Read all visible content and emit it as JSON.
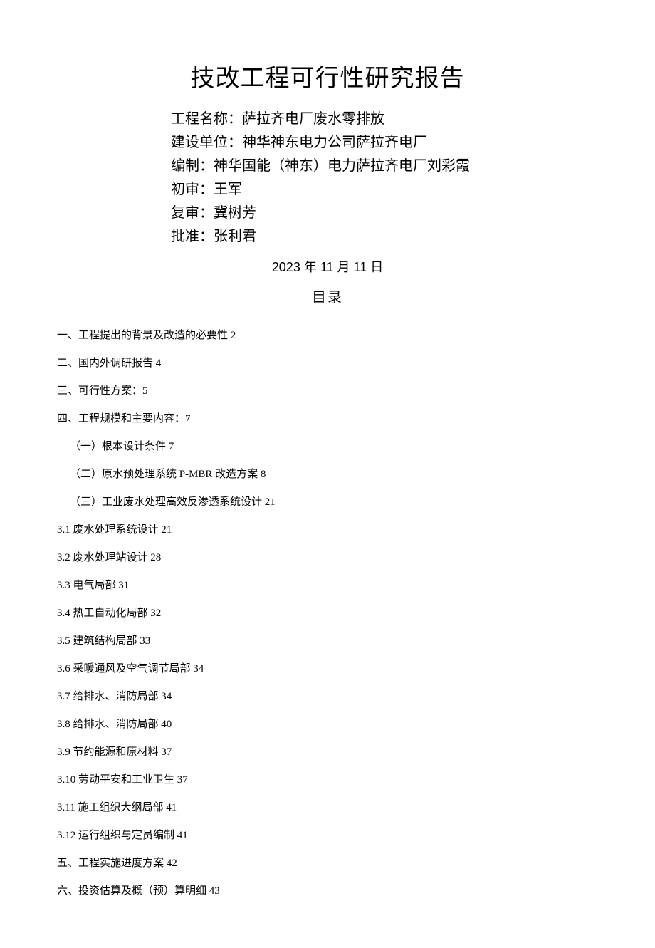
{
  "title": "技改工程可行性研究报告",
  "meta": {
    "project_name": "工程名称：萨拉齐电厂废水零排放",
    "build_unit": "建设单位：神华神东电力公司萨拉齐电厂",
    "author": "编制：神华国能（神东）电力萨拉齐电厂刘彩霞",
    "first_review": "初审：王军",
    "second_review": "复审：冀树芳",
    "approve": "批准：张利君"
  },
  "date": "2023 年 11 月 11 日",
  "toc_heading": "目录",
  "toc": [
    {
      "text": "一、工程提出的背景及改造的必要性 2",
      "sub": false
    },
    {
      "text": "二、国内外调研报告 4",
      "sub": false
    },
    {
      "text": "三、可行性方案：5",
      "sub": false
    },
    {
      "text": "四、工程规模和主要内容：7",
      "sub": false
    },
    {
      "text": "（一）根本设计条件 7",
      "sub": true
    },
    {
      "text": "（二）原水预处理系统 P-MBR 改造方案 8",
      "sub": true
    },
    {
      "text": "（三）工业废水处理高效反渗透系统设计 21",
      "sub": true
    },
    {
      "text": "3.1 废水处理系统设计 21",
      "sub": false
    },
    {
      "text": "3.2 废水处理站设计 28",
      "sub": false
    },
    {
      "text": "3.3 电气局部 31",
      "sub": false
    },
    {
      "text": "3.4 热工自动化局部 32",
      "sub": false
    },
    {
      "text": "3.5 建筑结构局部 33",
      "sub": false
    },
    {
      "text": "3.6 采暖通风及空气调节局部 34",
      "sub": false
    },
    {
      "text": "3.7 给排水、消防局部 34",
      "sub": false
    },
    {
      "text": "3.8 给排水、消防局部 40",
      "sub": false
    },
    {
      "text": "3.9 节约能源和原材料 37",
      "sub": false
    },
    {
      "text": "3.10 劳动平安和工业卫生 37",
      "sub": false
    },
    {
      "text": "3.11 施工组织大纲局部 41",
      "sub": false
    },
    {
      "text": "3.12 运行组织与定员编制 41",
      "sub": false
    },
    {
      "text": "五、工程实施进度方案 42",
      "sub": false
    },
    {
      "text": "六、投资估算及概（预）算明细 43",
      "sub": false
    }
  ]
}
